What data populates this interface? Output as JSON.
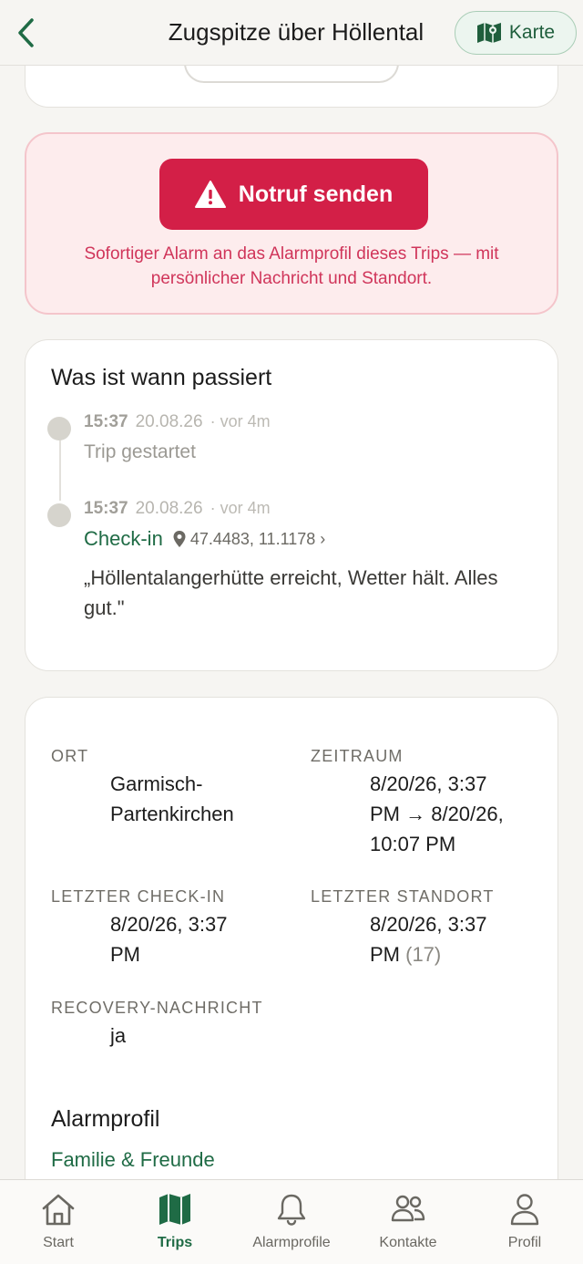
{
  "header": {
    "title": "Zugspitze über Höllental",
    "map_button": "Karte"
  },
  "sos": {
    "button_label": "Notruf senden",
    "note": "Sofortiger Alarm an das Alarmprofil dieses Trips — mit persönlicher Nachricht und Standort."
  },
  "events": {
    "title": "Was ist wann passiert",
    "items": [
      {
        "time": "15:37",
        "date": "20.08.26",
        "ago": "· vor 4m",
        "text": "Trip gestartet"
      },
      {
        "time": "15:37",
        "date": "20.08.26",
        "ago": "· vor 4m",
        "type": "Check-in",
        "coords": "47.4483, 11.1178 ›",
        "message": "„Höllentalangerhütte erreicht, Wetter hält. Alles gut.\""
      }
    ]
  },
  "details": {
    "ort_label": "ORT",
    "ort_value_1": "Garmisch-",
    "ort_value_2": "Partenkirchen",
    "zeitraum_label": "ZEITRAUM",
    "zeitraum_value_1": "8/20/26, 3:37",
    "zeitraum_value_2": "PM → 8/20/26,",
    "zeitraum_value_3": "10:07 PM",
    "letzter_checkin_label": "LETZTER CHECK-IN",
    "letzter_checkin_value_1": "8/20/26, 3:37",
    "letzter_checkin_value_2": "PM",
    "letzter_standort_label": "LETZTER STANDORT",
    "letzter_standort_value_1": "8/20/26, 3:37",
    "letzter_standort_value_2": "PM",
    "letzter_standort_count": "(17)",
    "recovery_label": "RECOVERY-NACHRICHT",
    "recovery_value": "ja",
    "alarmprofil_title": "Alarmprofil",
    "alarmprofil_link": "Familie & Freunde"
  },
  "tabbar": {
    "tabs": [
      {
        "label": "Start",
        "icon": "home-icon"
      },
      {
        "label": "Trips",
        "icon": "map-icon",
        "active": true
      },
      {
        "label": "Alarmprofile",
        "icon": "bell-icon"
      },
      {
        "label": "Kontakte",
        "icon": "people-icon"
      },
      {
        "label": "Profil",
        "icon": "person-icon"
      }
    ]
  },
  "colors": {
    "brand_green": "#1f6b45",
    "alert_red": "#d31f47",
    "background": "#f6f5f2"
  }
}
